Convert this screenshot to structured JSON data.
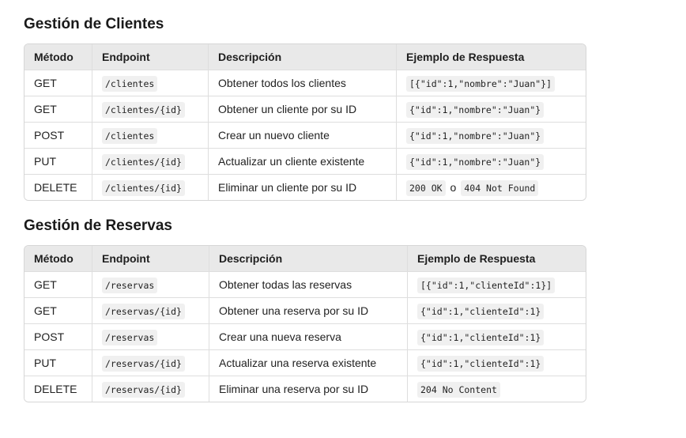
{
  "sections": [
    {
      "title": "Gestión de Clientes",
      "headers": [
        "Método",
        "Endpoint",
        "Descripción",
        "Ejemplo de Respuesta"
      ],
      "rows": [
        {
          "method": "GET",
          "endpoint": "/clientes",
          "description": "Obtener todos los clientes",
          "response": [
            "[{\"id\":1,\"nombre\":\"Juan\"}]"
          ]
        },
        {
          "method": "GET",
          "endpoint": "/clientes/{id}",
          "description": "Obtener un cliente por su ID",
          "response": [
            "{\"id\":1,\"nombre\":\"Juan\"}"
          ]
        },
        {
          "method": "POST",
          "endpoint": "/clientes",
          "description": "Crear un nuevo cliente",
          "response": [
            "{\"id\":1,\"nombre\":\"Juan\"}"
          ]
        },
        {
          "method": "PUT",
          "endpoint": "/clientes/{id}",
          "description": "Actualizar un cliente existente",
          "response": [
            "{\"id\":1,\"nombre\":\"Juan\"}"
          ]
        },
        {
          "method": "DELETE",
          "endpoint": "/clientes/{id}",
          "description": "Eliminar un cliente por su ID",
          "response": [
            "200 OK",
            "404 Not Found"
          ],
          "response_sep": "o"
        }
      ]
    },
    {
      "title": "Gestión de Reservas",
      "headers": [
        "Método",
        "Endpoint",
        "Descripción",
        "Ejemplo de Respuesta"
      ],
      "rows": [
        {
          "method": "GET",
          "endpoint": "/reservas",
          "description": "Obtener todas las reservas",
          "response": [
            "[{\"id\":1,\"clienteId\":1}]"
          ]
        },
        {
          "method": "GET",
          "endpoint": "/reservas/{id}",
          "description": "Obtener una reserva por su ID",
          "response": [
            "{\"id\":1,\"clienteId\":1}"
          ]
        },
        {
          "method": "POST",
          "endpoint": "/reservas",
          "description": "Crear una nueva reserva",
          "response": [
            "{\"id\":1,\"clienteId\":1}"
          ]
        },
        {
          "method": "PUT",
          "endpoint": "/reservas/{id}",
          "description": "Actualizar una reserva existente",
          "response": [
            "{\"id\":1,\"clienteId\":1}"
          ]
        },
        {
          "method": "DELETE",
          "endpoint": "/reservas/{id}",
          "description": "Eliminar una reserva por su ID",
          "response": [
            "204 No Content"
          ]
        }
      ]
    }
  ]
}
